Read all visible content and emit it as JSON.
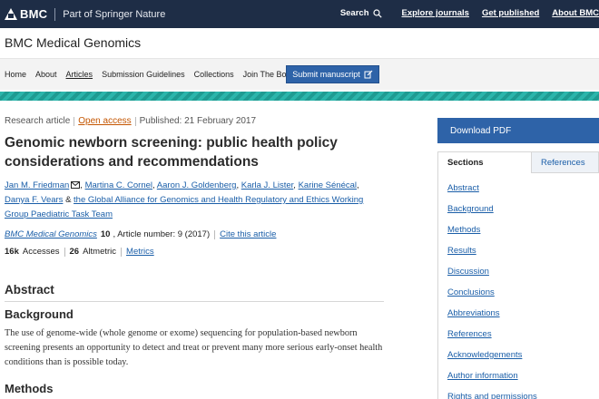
{
  "topbar": {
    "brand": "BMC",
    "subtitle": "Part of Springer Nature",
    "search_label": "Search",
    "links": [
      "Explore journals",
      "Get published",
      "About BMC"
    ]
  },
  "journal": {
    "title": "BMC Medical Genomics"
  },
  "subnav": {
    "items": [
      "Home",
      "About",
      "Articles",
      "Submission Guidelines",
      "Collections",
      "Join The Board"
    ],
    "active": "Articles",
    "submit_label": "Submit manuscript"
  },
  "article": {
    "type": "Research article",
    "access": "Open access",
    "published": "Published: 21 February 2017",
    "title": "Genomic newborn screening: public health policy considerations and recommendations",
    "authors": [
      "Jan M. Friedman",
      "Martina C. Cornel",
      "Aaron J. Goldenberg",
      "Karla J. Lister",
      "Karine Sénécal",
      "Danya F. Vears"
    ],
    "consortium_prefix": "&",
    "consortium": "the Global Alliance for Genomics and Health Regulatory and Ethics Working Group Paediatric Task Team",
    "journal_name": "BMC Medical Genomics",
    "volume": "10",
    "article_number": ", Article number: 9 (2017)",
    "cite_label": "Cite this article",
    "accesses_count": "16k",
    "accesses_label": "Accesses",
    "altmetric_count": "26",
    "altmetric_label": "Altmetric",
    "metrics_label": "Metrics"
  },
  "abstract": {
    "heading": "Abstract",
    "background_heading": "Background",
    "background_text": "The use of genome-wide (whole genome or exome) sequencing for population-based newborn screening presents an opportunity to detect and treat or prevent many more serious early-onset health conditions than is possible today.",
    "methods_heading": "Methods"
  },
  "sidebar": {
    "download_label": "Download PDF",
    "tabs": [
      "Sections",
      "References"
    ],
    "sections": [
      "Abstract",
      "Background",
      "Methods",
      "Results",
      "Discussion",
      "Conclusions",
      "Abbreviations",
      "References",
      "Acknowledgements",
      "Author information",
      "Rights and permissions"
    ]
  },
  "colors": {
    "topbar": "#1e2d46",
    "link": "#1a5ea8",
    "button": "#2e63a8",
    "open_access": "#c45500",
    "band": "#23a9a0"
  },
  "icons": {
    "search": "search-icon",
    "submit": "external-edit-icon",
    "mail": "mail-icon"
  }
}
